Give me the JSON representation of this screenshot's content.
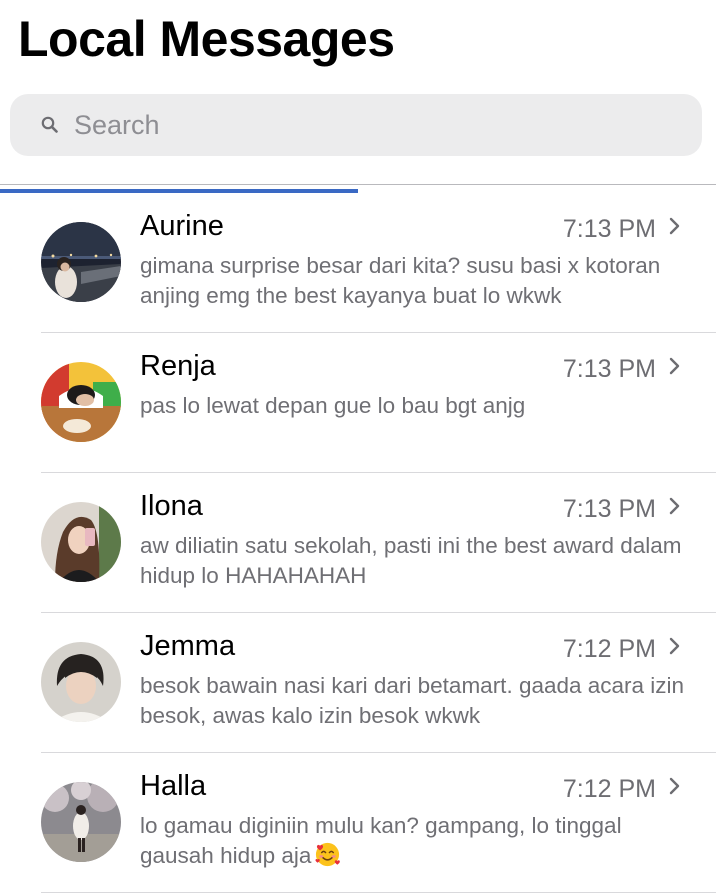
{
  "header": {
    "title": "Local Messages"
  },
  "search": {
    "placeholder": "Search",
    "icon": "magnifier-icon"
  },
  "load_progress": 0.5,
  "colors": {
    "progress": "#3a69c4",
    "search_bg": "#ececed",
    "secondary_text": "#6f6f74"
  },
  "conversations": [
    {
      "name": "Aurine",
      "time": "7:13 PM",
      "preview": "gimana surprise besar dari kita? susu basi x kotoran anjing emg the best kayanya buat lo wkwk",
      "chevron": "chevron-right-icon"
    },
    {
      "name": "Renja",
      "time": "7:13 PM",
      "preview": "pas lo lewat depan gue lo bau bgt anjg",
      "chevron": "chevron-right-icon"
    },
    {
      "name": "Ilona",
      "time": "7:13 PM",
      "preview": "aw diliatin satu sekolah, pasti ini the best award dalam hidup lo HAHAHAHAH",
      "chevron": "chevron-right-icon"
    },
    {
      "name": "Jemma",
      "time": "7:12 PM",
      "preview": "besok bawain nasi kari dari betamart. gaada acara izin besok, awas kalo izin besok wkwk",
      "chevron": "chevron-right-icon"
    },
    {
      "name": "Halla",
      "time": "7:12 PM",
      "preview": "lo gamau diginiin mulu kan? gampang, lo tinggal gausah hidup aja",
      "emoji": "smiling-face-with-hearts-emoji",
      "chevron": "chevron-right-icon"
    }
  ]
}
